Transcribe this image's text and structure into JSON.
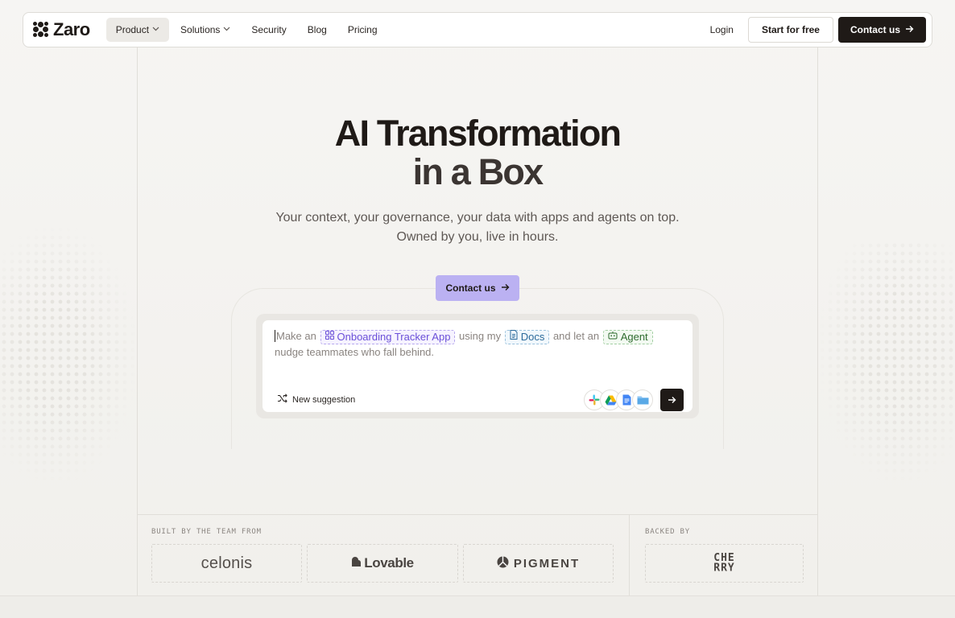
{
  "brand": {
    "name": "Zaro"
  },
  "nav": {
    "items": [
      {
        "label": "Product",
        "has_dropdown": true,
        "active": true
      },
      {
        "label": "Solutions",
        "has_dropdown": true,
        "active": false
      },
      {
        "label": "Security",
        "has_dropdown": false,
        "active": false
      },
      {
        "label": "Blog",
        "has_dropdown": false,
        "active": false
      },
      {
        "label": "Pricing",
        "has_dropdown": false,
        "active": false
      }
    ],
    "login_label": "Login",
    "start_label": "Start for free",
    "contact_label": "Contact us"
  },
  "hero": {
    "title_line1": "AI Transformation",
    "title_line2": "in a Box",
    "subtitle_line1": "Your context, your governance, your data with apps and agents on top.",
    "subtitle_line2": "Owned by you, live in hours.",
    "cta_label": "Contact us"
  },
  "prompt": {
    "text_1": "Make an",
    "chip_app": "Onboarding Tracker App",
    "text_2": "using my",
    "chip_docs": "Docs",
    "text_3": "and let an",
    "chip_agent": "Agent",
    "text_4": "nudge teammates who fall behind.",
    "suggestion_label": "New suggestion",
    "integrations": [
      "slack-icon",
      "google-drive-icon",
      "google-docs-icon",
      "folder-icon"
    ]
  },
  "logos": {
    "built_by_label": "BUILT BY THE TEAM FROM",
    "backed_by_label": "BACKED BY",
    "companies": [
      "celonis",
      "Lovable",
      "PIGMENT"
    ],
    "investor_line1": "CHE",
    "investor_line2": "RRY"
  },
  "colors": {
    "accent_purple": "#bbb1f2",
    "dark": "#1f1a17",
    "background": "#f4f3f1"
  }
}
